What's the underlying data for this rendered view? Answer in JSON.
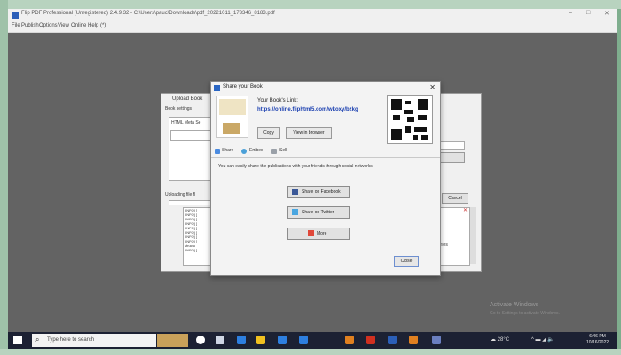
{
  "app": {
    "title": "Flip PDF Professional (Unregistered) 2.4.9.32 - C:\\Users\\pauc\\Downloads\\pdf_20221011_173346_8183.pdf",
    "menu": [
      "File",
      "Publish",
      "Options",
      "View",
      "Online",
      "Help (*)"
    ]
  },
  "background_dialog": {
    "title": "Upload Book",
    "book_settings": "Book settings",
    "html_meta": "HTML Meta Se",
    "uploading": "Uploading file fl",
    "cancel_label": "Cancel",
    "log_lines": [
      "[INFO] [",
      "[INFO] [",
      "[INFO] [",
      "[INFO] [",
      "[INFO] [",
      "[INFO] [",
      "[INFO] [",
      "[INFO] [",
      "structu",
      "[INFO] ["
    ],
    "side_note": "files"
  },
  "dialog": {
    "title": "Share your Book",
    "link_label": "Your Book's Link:",
    "link_url": "https://online.fliphtml5.com/wkoxy/bzkg",
    "copy_label": "Copy",
    "open_browser_label": "View in browser",
    "tabs": [
      {
        "label": "Share",
        "color": "#4b8be0"
      },
      {
        "label": "Embed",
        "color": "#4aa0d8"
      },
      {
        "label": "Sell",
        "color": "#9aa0a8"
      }
    ],
    "share_description": "You can easily share the publications with your friends through social networks.",
    "share_buttons": [
      {
        "label": "Share on Facebook",
        "color": "#3b5998"
      },
      {
        "label": "Share on Twitter",
        "color": "#4aa6e0"
      },
      {
        "label": "More",
        "color": "#e0483a"
      }
    ],
    "close_label": "Close"
  },
  "watermark": {
    "line1": "Activate Windows",
    "line2": "Go to Settings to activate Windows."
  },
  "taskbar": {
    "search_placeholder": "Type here to search",
    "weather": "28°C",
    "time": "6:46 PM",
    "date": "10/16/2022",
    "icon_colors": [
      "#ffffff",
      "#2d7fe0",
      "#f0c020",
      "#2d7fe0",
      "#d03020",
      "#e08020",
      "#d03020",
      "#2b5fb8",
      "#e08020",
      "#6a7fc0"
    ]
  }
}
